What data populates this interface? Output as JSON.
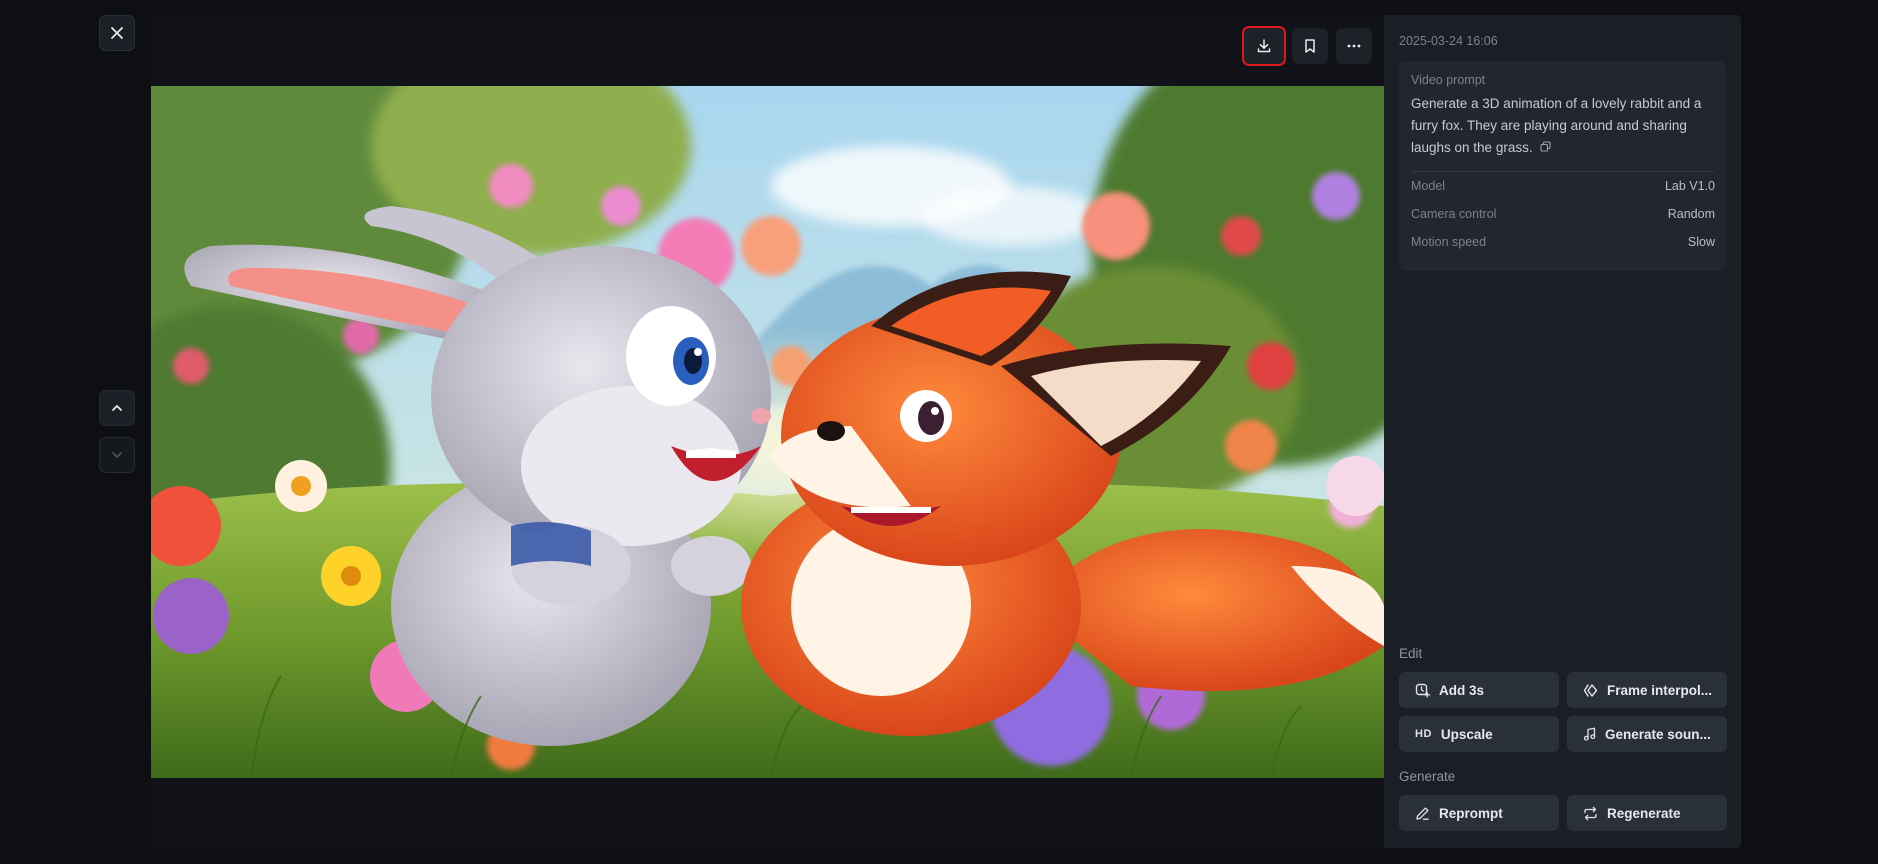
{
  "viewer": {
    "close_icon": "close-icon",
    "nav_up_icon": "chevron-up-icon",
    "nav_down_icon": "chevron-down-icon",
    "toolbar": {
      "download_icon": "download-icon",
      "bookmark_icon": "bookmark-icon",
      "more_icon": "more-icon"
    },
    "highlight_color": "#e0161b"
  },
  "panel": {
    "timestamp": "2025-03-24 16:06",
    "prompt_label": "Video prompt",
    "prompt_text": "Generate a 3D animation of a lovely rabbit and a furry fox. They are playing around and sharing laughs on the grass.",
    "meta": [
      {
        "key": "Model",
        "value": "Lab V1.0"
      },
      {
        "key": "Camera control",
        "value": "Random"
      },
      {
        "key": "Motion speed",
        "value": "Slow"
      }
    ],
    "edit_title": "Edit",
    "edit_actions": [
      {
        "label": "Add 3s",
        "icon": "add-time-icon"
      },
      {
        "label": "Frame interpol...",
        "icon": "frame-interpolation-icon"
      },
      {
        "label": "Upscale",
        "icon": "hd-icon",
        "icon_text": "HD"
      },
      {
        "label": "Generate soun...",
        "icon": "music-note-icon"
      }
    ],
    "generate_title": "Generate",
    "generate_actions": [
      {
        "label": "Reprompt",
        "icon": "pencil-icon"
      },
      {
        "label": "Regenerate",
        "icon": "repeat-icon"
      }
    ]
  }
}
